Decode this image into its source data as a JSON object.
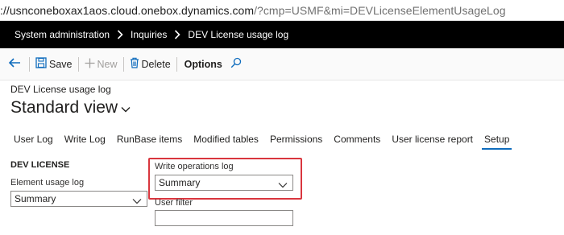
{
  "browser": {
    "url_host": "://usnconeboxax1aos.cloud.onebox.dynamics.com",
    "url_path": "/?cmp=USMF&mi=DEVLicenseElementUsageLog"
  },
  "breadcrumb": {
    "items": [
      "System administration",
      "Inquiries",
      "DEV License usage log"
    ]
  },
  "actions": {
    "save_label": "Save",
    "new_label": "New",
    "delete_label": "Delete",
    "options_label": "Options"
  },
  "page": {
    "caption": "DEV License usage log",
    "view_title": "Standard view"
  },
  "tabs": [
    {
      "label": "User Log"
    },
    {
      "label": "Write Log"
    },
    {
      "label": "RunBase items"
    },
    {
      "label": "Modified tables"
    },
    {
      "label": "Permissions"
    },
    {
      "label": "Comments"
    },
    {
      "label": "User license report"
    },
    {
      "label": "Setup",
      "active": true
    }
  ],
  "form": {
    "group_title": "DEV LICENSE",
    "element_usage_log": {
      "label": "Element usage log",
      "value": "Summary"
    },
    "write_operations_log": {
      "label": "Write operations log",
      "value": "Summary"
    },
    "user_filter": {
      "label": "User filter",
      "value": ""
    }
  },
  "colors": {
    "nav_background": "#000000",
    "active_tab_underline": "#0f6cbd",
    "highlight_box": "#d9363e"
  }
}
